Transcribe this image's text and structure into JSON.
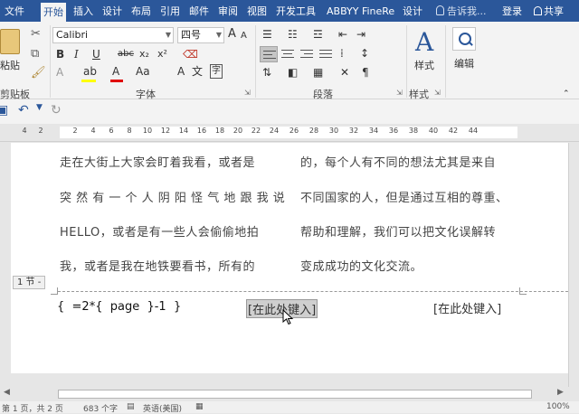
{
  "tabs": [
    {
      "label": "文件",
      "active": false
    },
    {
      "label": "开始",
      "active": true
    },
    {
      "label": "插入",
      "active": false
    },
    {
      "label": "设计",
      "active": false
    },
    {
      "label": "布局",
      "active": false
    },
    {
      "label": "引用",
      "active": false
    },
    {
      "label": "邮件",
      "active": false
    },
    {
      "label": "审阅",
      "active": false
    },
    {
      "label": "视图",
      "active": false
    },
    {
      "label": "开发工具",
      "active": false
    },
    {
      "label": "ABBYY FineRea",
      "active": false
    },
    {
      "label": "设计",
      "active": false
    }
  ],
  "tell_me": "告诉我...",
  "login": "登录",
  "share": "共享",
  "ribbon": {
    "paste_label": "粘贴",
    "clipboard_label": "剪贴板",
    "font_name": "Calibri",
    "font_size": "四号",
    "font_group_label": "字体",
    "paragraph_group_label": "段落",
    "styles_label": "样式",
    "styles_group_label": "样式",
    "editing_label": "编辑",
    "bold": "B",
    "italic": "I",
    "underline": "U",
    "strike": "abc",
    "subscript": "x₂",
    "superscript": "x²",
    "grow_font": "A",
    "shrink_font": "A",
    "aa": "Aa",
    "font_color_a": "A",
    "font_a2": "A",
    "wen": "文",
    "style_glyph": "A",
    "highlight_color": "#ffff00",
    "font_color": "#e00000"
  },
  "ruler": {
    "numbers": [
      "4",
      "2",
      "2",
      "4",
      "6",
      "8",
      "10",
      "12",
      "14",
      "16",
      "18",
      "20",
      "22",
      "24",
      "26",
      "28",
      "30",
      "32",
      "34",
      "36",
      "38",
      "40",
      "42",
      "44"
    ]
  },
  "document": {
    "col1": [
      "走在大街上大家会盯着我看，或者是",
      "突 然 有 一 个 人 阴 阳 怪 气 地 跟 我 说",
      "HELLO，或者是有一些人会偷偷地拍",
      "我，或者是我在地铁要看书，所有的"
    ],
    "col2": [
      "的，每个人有不同的想法尤其是来自",
      "不同国家的人，但是通过互相的尊重、",
      "帮助和理解，我们可以把文化误解转",
      "变成成功的文化交流。"
    ],
    "section_tag": "1 节 -",
    "field_code": "{  =2*{  page  }-1  }",
    "placeholder_center": "[在此处键入]",
    "placeholder_right": "[在此处键入]"
  },
  "status": {
    "page": "第 1 页，共 2 页",
    "words": "683 个字",
    "language": "英语(美国)",
    "zoom": "100%"
  }
}
